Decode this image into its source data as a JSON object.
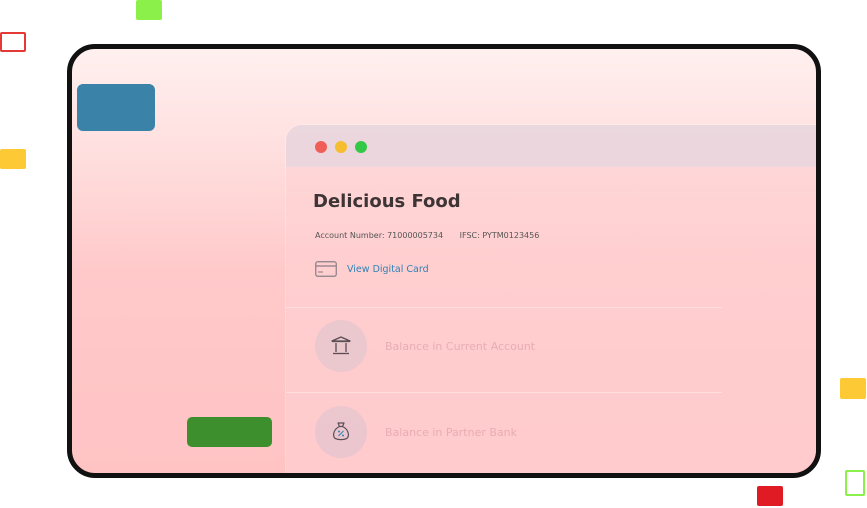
{
  "colors": {
    "frame_background": "#ffc9ca",
    "frame_border": "#111111",
    "link": "#2f82b8",
    "title": "#3d3535",
    "confetti": [
      "#8bf049",
      "#e53935",
      "#fdc934",
      "#4caf50"
    ]
  },
  "window": {
    "title": "Delicious Food",
    "account_number": "Account Number: 71000005734",
    "ifsc": "IFSC: PYTM0123456",
    "card_link": "View Digital Card",
    "rows": [
      {
        "label": "Balance in Current Account",
        "icon": "bank-icon"
      },
      {
        "label": "Balance in Partner Bank",
        "icon": "money-bag-icon"
      }
    ]
  }
}
